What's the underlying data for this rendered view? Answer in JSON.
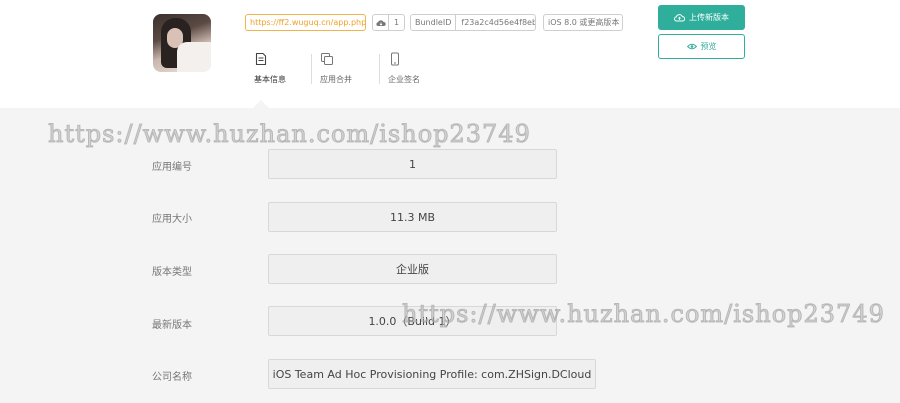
{
  "header": {
    "app_url": "https://ff2.wuguq.cn/app.php/1",
    "download_count": "1",
    "bundle_label": "BundleID",
    "bundle_id": "f23a2c4d56e4f8eb",
    "ios_requirement": "iOS 8.0 或更高版本",
    "upload_button": "上传新版本",
    "preview_button": "预览"
  },
  "tabs": [
    {
      "label": "基本信息",
      "icon": "document-icon"
    },
    {
      "label": "应用合并",
      "icon": "copy-icon"
    },
    {
      "label": "企业签名",
      "icon": "phone-icon"
    }
  ],
  "details": [
    {
      "label": "应用编号",
      "value": "1"
    },
    {
      "label": "应用大小",
      "value": "11.3 MB"
    },
    {
      "label": "版本类型",
      "value": "企业版"
    },
    {
      "label": "最新版本",
      "value": "1.0.0（Build 1）"
    },
    {
      "label": "公司名称",
      "value": "iOS Team Ad Hoc Provisioning Profile: com.ZHSign.DCloud"
    }
  ],
  "watermark": "https://www.huzhan.com/ishop23749",
  "colors": {
    "accent": "#2fae9c",
    "url_tag": "#f1a028"
  }
}
